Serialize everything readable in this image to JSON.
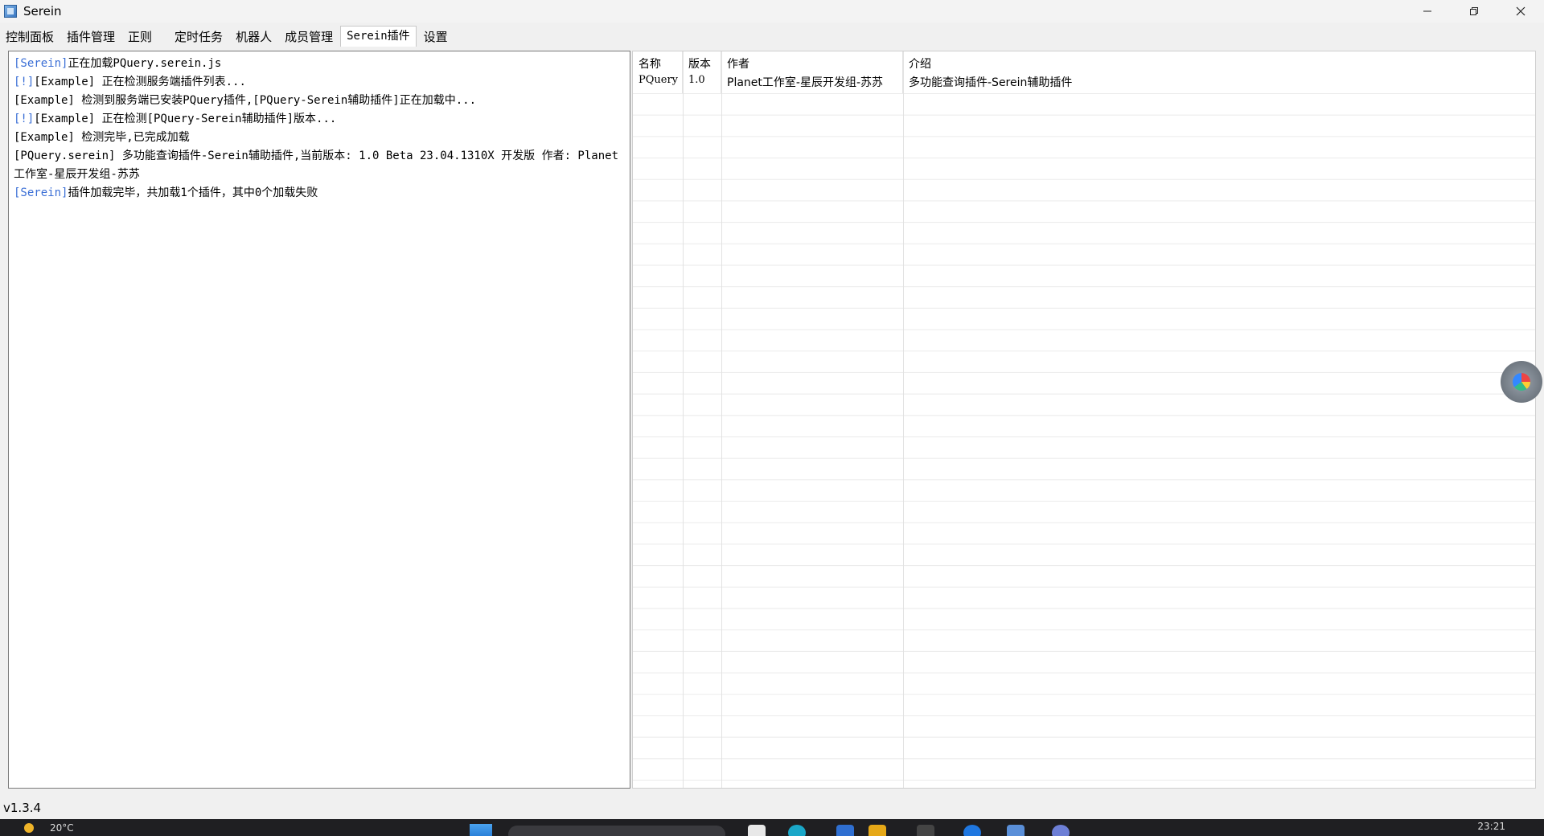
{
  "window": {
    "title": "Serein",
    "icons": {
      "app": "serein-app-icon",
      "minimize": "minimize-icon",
      "maximize": "restore-icon",
      "close": "close-icon"
    }
  },
  "tabs": [
    {
      "label": "控制面板",
      "active": false
    },
    {
      "label": "插件管理",
      "active": false
    },
    {
      "label": "正则",
      "active": false
    },
    {
      "label": "定时任务",
      "active": false
    },
    {
      "label": "机器人",
      "active": false
    },
    {
      "label": "成员管理",
      "active": false
    },
    {
      "label": "Serein插件",
      "active": true
    },
    {
      "label": "设置",
      "active": false
    }
  ],
  "console": {
    "lines": [
      {
        "tag": "[Serein]",
        "tag_color": "blue",
        "text": "正在加载PQuery.serein.js"
      },
      {
        "tag": "[!]",
        "tag_color": "blue",
        "text": "[Example] 正在检测服务端插件列表..."
      },
      {
        "tag": "",
        "tag_color": "",
        "text": "[Example] 检测到服务端已安装PQuery插件,[PQuery-Serein辅助插件]正在加载中..."
      },
      {
        "tag": "[!]",
        "tag_color": "blue",
        "text": "[Example] 正在检测[PQuery-Serein辅助插件]版本..."
      },
      {
        "tag": "",
        "tag_color": "",
        "text": "[Example] 检测完毕,已完成加载"
      },
      {
        "tag": "",
        "tag_color": "",
        "text": "[PQuery.serein] 多功能查询插件-Serein辅助插件,当前版本: 1.0 Beta 23.04.1310X 开发版 作者: Planet工作室-星辰开发组-苏苏"
      },
      {
        "tag": "[Serein]",
        "tag_color": "blue",
        "text": "插件加载完毕，共加载1个插件，其中0个加载失败"
      }
    ]
  },
  "plugin_table": {
    "columns": [
      "名称",
      "版本",
      "作者",
      "介绍"
    ],
    "rows": [
      [
        "PQuery",
        "1.0",
        "Planet工作室-星辰开发组-苏苏",
        "多功能查询插件-Serein辅助插件"
      ]
    ]
  },
  "floating_button": {
    "icon": "assistant-orb-icon"
  },
  "status": {
    "version": "v1.3.4"
  },
  "taskbar": {
    "weather": "20°C",
    "clock": "23:21",
    "icons": [
      "weather-sun-icon",
      "start-icon",
      "search-box",
      "app-icon"
    ]
  },
  "colors": {
    "accent_tag": "#3b6fd6",
    "taskbar": "#1f1f22"
  }
}
